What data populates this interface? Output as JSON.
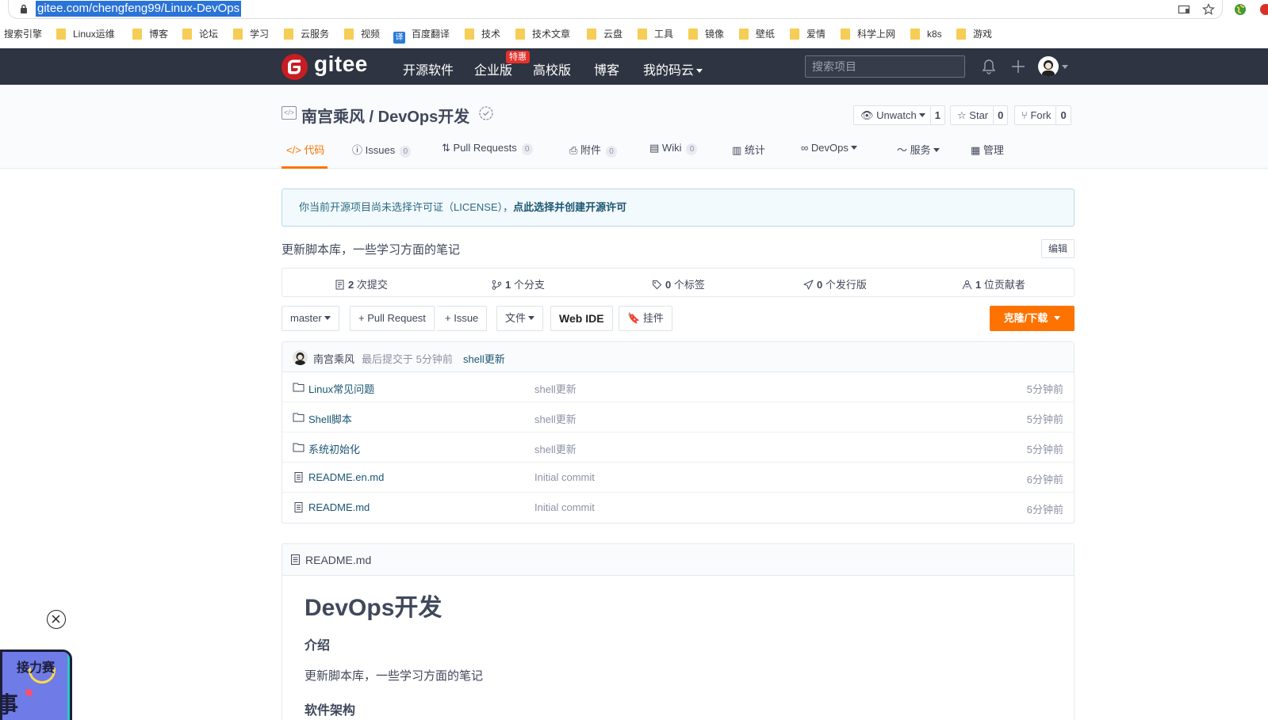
{
  "browser": {
    "url": "gitee.com/chengfeng99/Linux-DevOps",
    "bookmarks": [
      {
        "label": "搜索引擎",
        "type": "none"
      },
      {
        "label": "Linux运维",
        "type": "folder"
      },
      {
        "label": "博客",
        "type": "folder"
      },
      {
        "label": "论坛",
        "type": "folder"
      },
      {
        "label": "学习",
        "type": "folder"
      },
      {
        "label": "云服务",
        "type": "folder"
      },
      {
        "label": "视频",
        "type": "folder"
      },
      {
        "label": "百度翻译",
        "type": "translate"
      },
      {
        "label": "技术",
        "type": "folder"
      },
      {
        "label": "技术文章",
        "type": "folder"
      },
      {
        "label": "云盘",
        "type": "folder"
      },
      {
        "label": "工具",
        "type": "folder"
      },
      {
        "label": "镜像",
        "type": "folder"
      },
      {
        "label": "壁纸",
        "type": "folder"
      },
      {
        "label": "爱情",
        "type": "folder"
      },
      {
        "label": "科学上网",
        "type": "folder"
      },
      {
        "label": "k8s",
        "type": "folder"
      },
      {
        "label": "游戏",
        "type": "folder"
      }
    ],
    "translate_glyph": "译"
  },
  "header": {
    "logo_text": "gitee",
    "nav": [
      "开源软件",
      "企业版",
      "高校版",
      "博客",
      "我的码云"
    ],
    "badge": "特惠",
    "search_placeholder": "搜索项目"
  },
  "repo": {
    "title": "南宫乘风 / DevOps开发",
    "watch": {
      "label": "Unwatch",
      "count": "1"
    },
    "star": {
      "label": "Star",
      "count": "0"
    },
    "fork": {
      "label": "Fork",
      "count": "0"
    },
    "tabs": [
      {
        "label": "代码",
        "count": null,
        "active": true
      },
      {
        "label": "Issues",
        "count": "0"
      },
      {
        "label": "Pull Requests",
        "count": "0"
      },
      {
        "label": "附件",
        "count": "0"
      },
      {
        "label": "Wiki",
        "count": "0"
      },
      {
        "label": "统计",
        "count": null
      },
      {
        "label": "DevOps",
        "count": null
      },
      {
        "label": "服务",
        "count": null
      },
      {
        "label": "管理",
        "count": null
      }
    ]
  },
  "notice": {
    "text": "你当前开源项目尚未选择许可证（LICENSE），",
    "link": "点此选择并创建开源许可"
  },
  "description": "更新脚本库，一些学习方面的笔记",
  "edit_label": "编辑",
  "stats": [
    {
      "num": "2",
      "label": " 次提交"
    },
    {
      "num": "1",
      "label": " 个分支"
    },
    {
      "num": "0",
      "label": " 个标签"
    },
    {
      "num": "0",
      "label": " 个发行版"
    },
    {
      "num": "1",
      "label": " 位贡献者"
    }
  ],
  "toolbar": {
    "branch": "master",
    "pull_request": "+ Pull Request",
    "issue": "+ Issue",
    "file": "文件",
    "web_ide": "Web IDE",
    "widget": "挂件",
    "clone": "克隆/下载"
  },
  "last_commit": {
    "author": "南宫乘风",
    "text": "最后提交于 5分钟前",
    "message": "shell更新"
  },
  "files": [
    {
      "name": "Linux常见问题",
      "type": "folder",
      "message": "shell更新",
      "time": "5分钟前"
    },
    {
      "name": "Shell脚本",
      "type": "folder",
      "message": "shell更新",
      "time": "5分钟前"
    },
    {
      "name": "系统初始化",
      "type": "folder",
      "message": "shell更新",
      "time": "5分钟前"
    },
    {
      "name": "README.en.md",
      "type": "file",
      "message": "Initial commit",
      "time": "6分钟前"
    },
    {
      "name": "README.md",
      "type": "file",
      "message": "Initial commit",
      "time": "6分钟前"
    }
  ],
  "readme": {
    "filename": "README.md",
    "h1": "DevOps开发",
    "h2_intro": "介绍",
    "intro_text": "更新脚本库，一些学习方面的笔记",
    "h2_arch": "软件架构"
  },
  "floating": {
    "title": "接力赛",
    "big_char": "事"
  },
  "colors": {
    "header_bg": "#2e3441",
    "accent": "#fe7300",
    "link": "#1b5672",
    "brand_red": "#c71d23"
  }
}
